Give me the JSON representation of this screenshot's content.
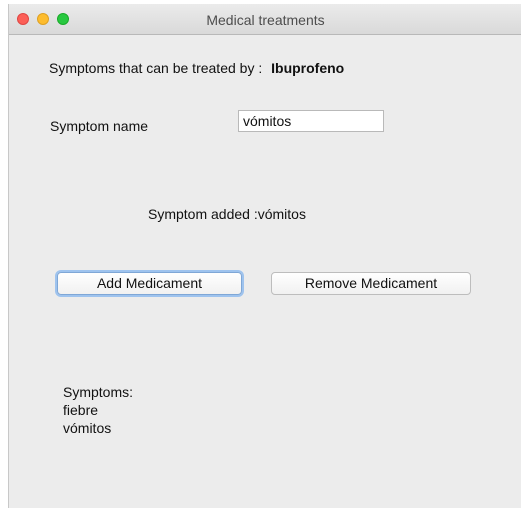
{
  "window": {
    "title": "Medical treatments"
  },
  "header": {
    "prefix": "Symptoms that can be treated by :",
    "medicament": "Ibuprofeno"
  },
  "form": {
    "symptom_label": "Symptom name",
    "symptom_value": "vómitos"
  },
  "status": {
    "message": "Symptom added :vómitos"
  },
  "buttons": {
    "add_label": "Add Medicament",
    "remove_label": "Remove Medicament"
  },
  "symptoms": {
    "heading": "Symptoms:",
    "items": [
      "fiebre",
      "vómitos"
    ]
  },
  "colors": {
    "close": "#fc5f57",
    "minimize": "#fdbc2e",
    "maximize": "#28c840",
    "focus_ring": "#9ec3ee"
  }
}
